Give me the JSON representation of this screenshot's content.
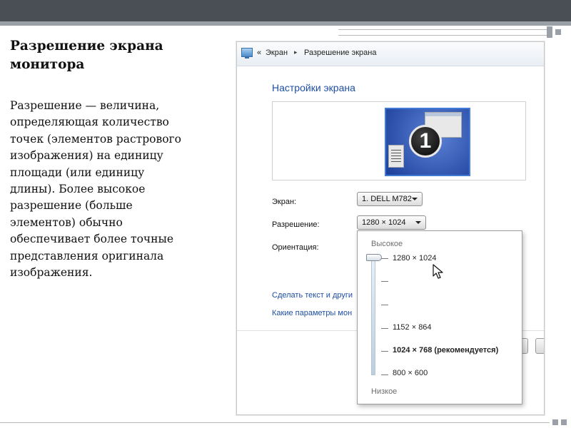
{
  "slide": {
    "title_line1": "Разрешение экрана",
    "title_line2": "монитора",
    "body": [
      "Разрешение — величина,",
      "определяющая количество",
      "точек (элементов растрового",
      "изображения) на единицу",
      "площади (или единицу",
      "длины). Более высокое",
      "разрешение (больше",
      "элементов) обычно",
      "обеспечивает более точные",
      "представления оригинала",
      "изображения."
    ]
  },
  "screenshot": {
    "breadcrumb": {
      "back": "«",
      "item1": "Экран",
      "item2": "Разрешение экрана",
      "separator": "▸"
    },
    "section_title": "Настройки экрана",
    "monitor_number": "1",
    "screen_label": "Экран:",
    "screen_value": "1. DELL M782",
    "resolution_label": "Разрешение:",
    "resolution_value": "1280 × 1024",
    "orientation_label": "Ориентация:",
    "link1": "Сделать текст и други",
    "link2": "Какие параметры мон",
    "popup": {
      "high": "Высокое",
      "low": "Низкое",
      "current_level": 1.0,
      "options": [
        {
          "label": "1280 × 1024",
          "bold": false
        },
        {
          "label": "1152 × 864",
          "bold": false
        },
        {
          "label": "1024 × 768 (рекомендуется)",
          "bold": true
        },
        {
          "label": "800 × 600",
          "bold": false
        }
      ]
    }
  },
  "colors": {
    "link": "#1e4fa3",
    "top_bar": "#4a4e55",
    "monitor": "#2c57b8"
  },
  "icons": [
    "monitor-icon",
    "cursor-icon",
    "dropdown-arrow-icon"
  ]
}
